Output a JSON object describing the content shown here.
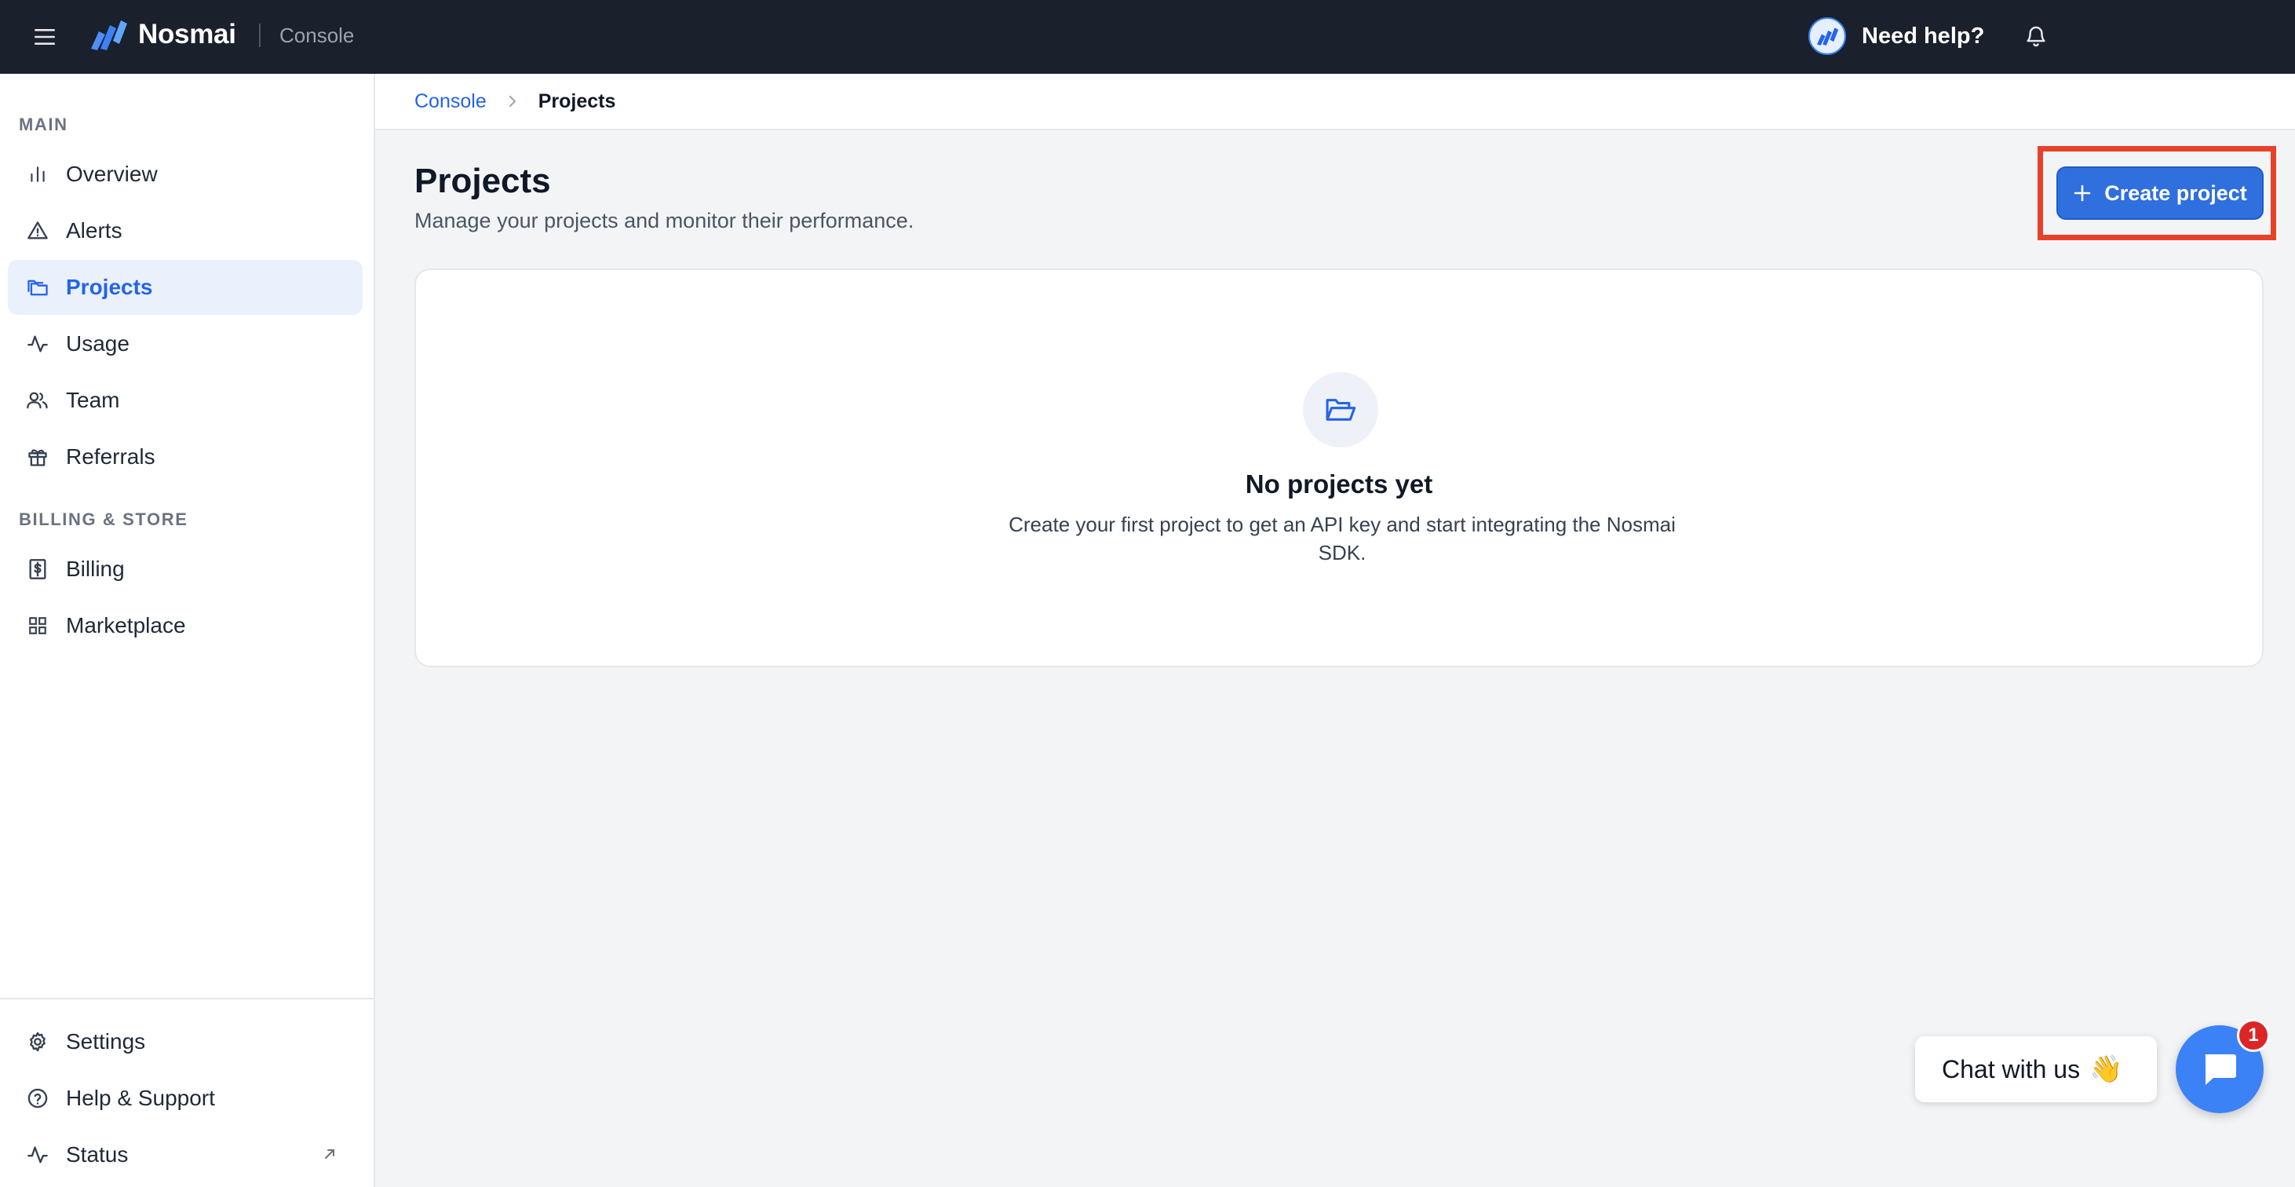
{
  "header": {
    "brand": "Nosmai",
    "subtitle": "Console",
    "help_label": "Need help?",
    "icons": [
      "menu-icon",
      "nosmai-logo",
      "help-avatar-icon",
      "bell-icon"
    ]
  },
  "sidebar": {
    "sections": [
      {
        "title": "MAIN"
      },
      {
        "title": "BILLING & STORE"
      }
    ],
    "items": [
      {
        "label": "Overview",
        "icon": "bar-chart-icon"
      },
      {
        "label": "Alerts",
        "icon": "warning-icon"
      },
      {
        "label": "Projects",
        "icon": "folders-icon",
        "active": true
      },
      {
        "label": "Usage",
        "icon": "activity-icon"
      },
      {
        "label": "Team",
        "icon": "users-icon"
      },
      {
        "label": "Referrals",
        "icon": "gift-icon"
      },
      {
        "label": "Billing",
        "icon": "receipt-dollar-icon"
      },
      {
        "label": "Marketplace",
        "icon": "grid-icon"
      }
    ],
    "bottom_items": [
      {
        "label": "Settings",
        "icon": "gear-icon"
      },
      {
        "label": "Help & Support",
        "icon": "help-circle-icon"
      },
      {
        "label": "Status",
        "icon": "activity-icon",
        "external": true
      }
    ]
  },
  "breadcrumb": {
    "items": [
      "Console",
      "Projects"
    ]
  },
  "page": {
    "title": "Projects",
    "subtitle": "Manage your projects and monitor their performance.",
    "create_button_label": "Create project"
  },
  "empty_state": {
    "icon": "folder-open-icon",
    "title": "No projects yet",
    "description": "Create your first project to get an API key and start integrating the Nosmai SDK."
  },
  "chat": {
    "label": "Chat with us",
    "emoji": "👋",
    "badge_count": "1"
  },
  "colors": {
    "topbar": "#1a202c",
    "accent": "#2563eb",
    "button": "#2f6fde",
    "highlight_outline": "#e8412a",
    "badge": "#dc2626"
  }
}
